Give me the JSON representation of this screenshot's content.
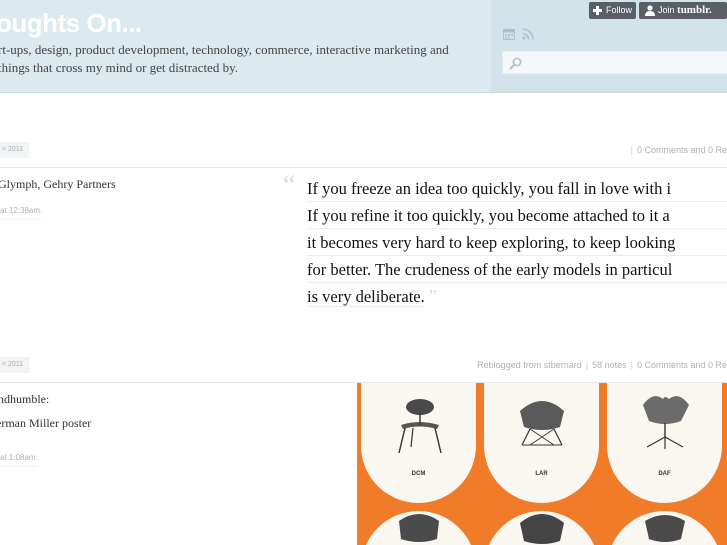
{
  "header": {
    "site_title": "oughts On...",
    "description": "rt-ups, design, product development, technology, commerce, interactive marketing and things that cross my mind or get distracted by.",
    "follow_label": "Follow",
    "join_label": "Join",
    "join_brand": "tumblr.",
    "search_placeholder": ""
  },
  "posts": [
    {
      "date": "< 2011",
      "meta": {
        "comments": "0 Comments and 0 Re"
      },
      "source": "Glymph, Gehry Partners",
      "time": "at 12:38am.",
      "quote_lines": [
        "If you freeze an idea too quickly, you fall in love with i",
        "If you refine it too quickly, you become attached to it a",
        "it becomes very hard to keep exploring, to keep looking",
        "for better. The crudeness of the early models in particul",
        "is very deliberate."
      ]
    },
    {
      "date": "< 2011",
      "meta": {
        "reblogged": "Reblogged from stbernard",
        "notes": "58 notes",
        "comments": "0 Comments and 0 Re"
      },
      "source_line1": "ndhumble:",
      "source_line2": "erman Miller poster",
      "time": "at 1:08am.",
      "poster_labels": [
        "DCM",
        "LAR",
        "DAF"
      ]
    }
  ],
  "colors": {
    "header_bg": "#dce9ee",
    "poster_orange": "#f07c2a",
    "button_bg": "#5a5f66"
  },
  "icons": [
    "plus-icon",
    "user-icon",
    "calendar-icon",
    "rss-icon",
    "search-icon"
  ]
}
